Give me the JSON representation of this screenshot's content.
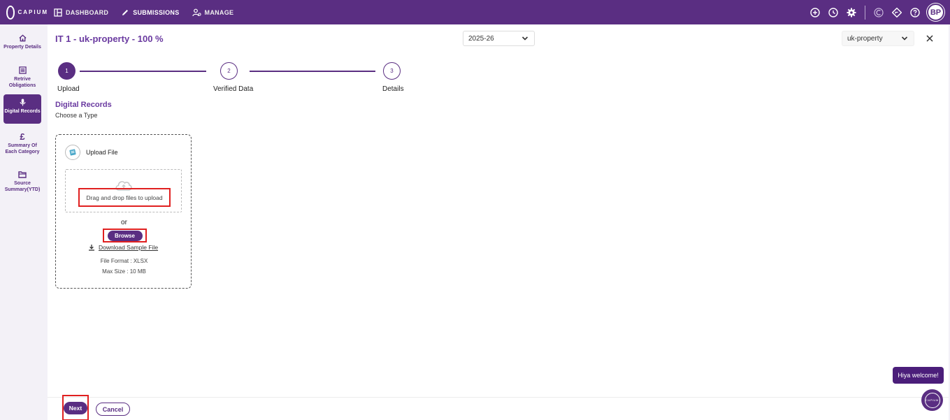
{
  "app": {
    "logo_text": "CAPIUM"
  },
  "nav": {
    "dashboard": "DASHBOARD",
    "submissions": "SUBMISSIONS",
    "manage": "MANAGE"
  },
  "user": {
    "initials": "BP"
  },
  "sidebar": {
    "items": [
      {
        "label": "Property Details",
        "icon": "home-icon",
        "active": false
      },
      {
        "label": "Retrive Obligations",
        "icon": "list-icon",
        "active": false
      },
      {
        "label": "Digital Records",
        "icon": "microphone-icon",
        "active": true
      },
      {
        "label": "Summary Of Each Category",
        "icon": "pound-icon",
        "active": false
      },
      {
        "label": "Source Summary(YTD)",
        "icon": "folder-icon",
        "active": false
      }
    ]
  },
  "header": {
    "title": "IT 1 - uk-property - 100 %",
    "year_select": "2025-26",
    "business_select": "uk-property"
  },
  "stepper": {
    "steps": [
      {
        "number": "1",
        "label": "Upload",
        "active": true
      },
      {
        "number": "2",
        "label": "Verified Data",
        "active": false
      },
      {
        "number": "3",
        "label": "Details",
        "active": false
      }
    ]
  },
  "section": {
    "title": "Digital Records",
    "subtitle": "Choose a Type"
  },
  "upload": {
    "card_title": "Upload File",
    "dropzone_text": "Drag and drop files to upload",
    "or_text": "or",
    "browse_label": "Browse",
    "download_label": "Download Sample File",
    "file_format": "File Format : XLSX",
    "max_size": "Max Size : 10 MB"
  },
  "footer": {
    "next_label": "Next",
    "cancel_label": "Cancel"
  },
  "chat": {
    "greeting": "Hiya welcome!",
    "bubble_text": "CAPIUM"
  },
  "colors": {
    "brand": "#5a2e82",
    "accent_text": "#6a3aa0",
    "highlight": "#e02020"
  }
}
